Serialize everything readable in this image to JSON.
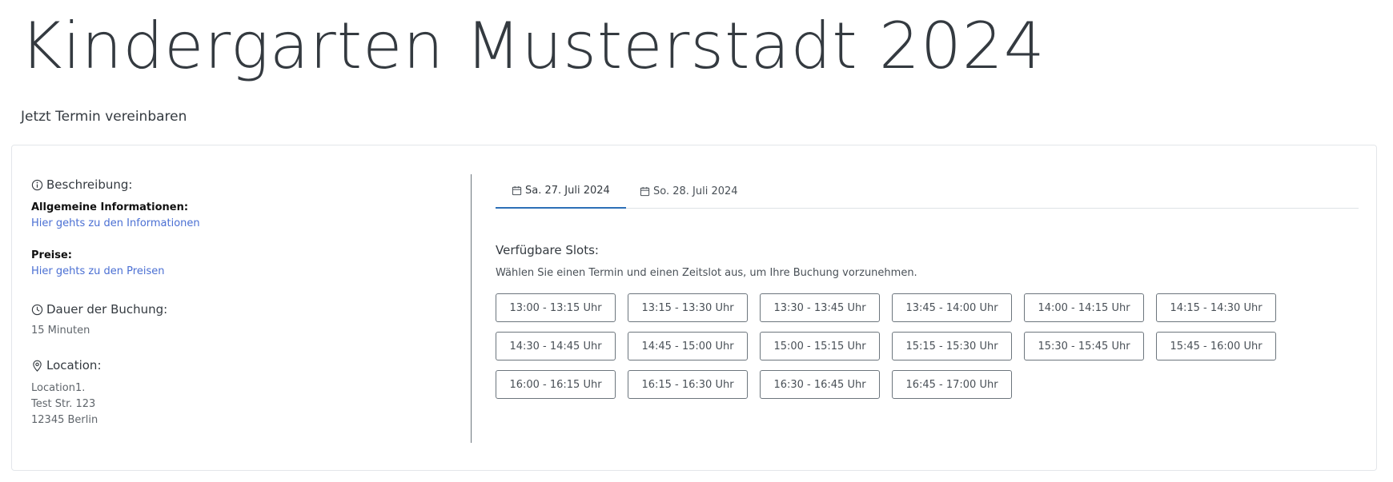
{
  "header": {
    "title": "Kindergarten Musterstadt 2024",
    "subtitle": "Jetzt Termin vereinbaren"
  },
  "info": {
    "description_label": "Beschreibung:",
    "general_label": "Allgemeine Informationen:",
    "general_link": "Hier gehts zu den Informationen",
    "prices_label": "Preise:",
    "prices_link": "Hier gehts zu den Preisen",
    "duration_label": "Dauer der Buchung:",
    "duration_value": "15 Minuten",
    "location_label": "Location:",
    "location_lines": [
      "Location1.",
      "Test Str. 123",
      "12345 Berlin"
    ]
  },
  "tabs": [
    {
      "label": "Sa. 27. Juli 2024",
      "active": true,
      "icon": "calendar-icon"
    },
    {
      "label": "So. 28. Juli 2024",
      "active": false,
      "icon": "calendar-icon"
    }
  ],
  "slots": {
    "title": "Verfügbare Slots:",
    "hint": "Wählen Sie einen Termin und einen Zeitslot aus, um Ihre Buchung vorzunehmen.",
    "items": [
      "13:00 - 13:15 Uhr",
      "13:15 - 13:30 Uhr",
      "13:30 - 13:45 Uhr",
      "13:45 - 14:00 Uhr",
      "14:00 - 14:15 Uhr",
      "14:15 - 14:30 Uhr",
      "14:30 - 14:45 Uhr",
      "14:45 - 15:00 Uhr",
      "15:00 - 15:15 Uhr",
      "15:15 - 15:30 Uhr",
      "15:30 - 15:45 Uhr",
      "15:45 - 16:00 Uhr",
      "16:00 - 16:15 Uhr",
      "16:15 - 16:30 Uhr",
      "16:30 - 16:45 Uhr",
      "16:45 - 17:00 Uhr"
    ]
  },
  "colors": {
    "link": "#4a6fd3",
    "active_tab_underline": "#2c6fb7",
    "text": "#343a40",
    "border": "#6c757d"
  }
}
